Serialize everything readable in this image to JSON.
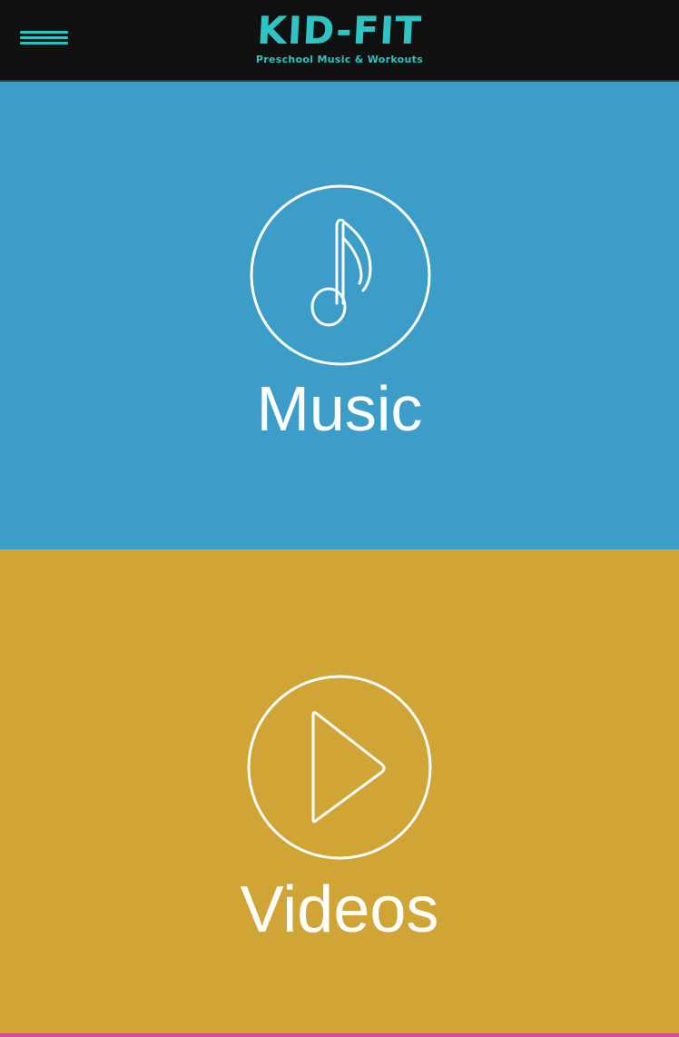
{
  "colors": {
    "header_bg": "#111111",
    "accent": "#2ec4c4",
    "music_bg": "#3b9dc8",
    "videos_bg": "#d0a535",
    "bottom_strip": "#d94b8c",
    "icon_stroke": "#ffffff"
  },
  "header": {
    "menu_icon": "hamburger-icon",
    "title": "KID-FIT",
    "subtitle": "Preschool Music & Workouts"
  },
  "tiles": [
    {
      "label": "Music",
      "icon": "music-note-icon"
    },
    {
      "label": "Videos",
      "icon": "play-icon"
    }
  ]
}
